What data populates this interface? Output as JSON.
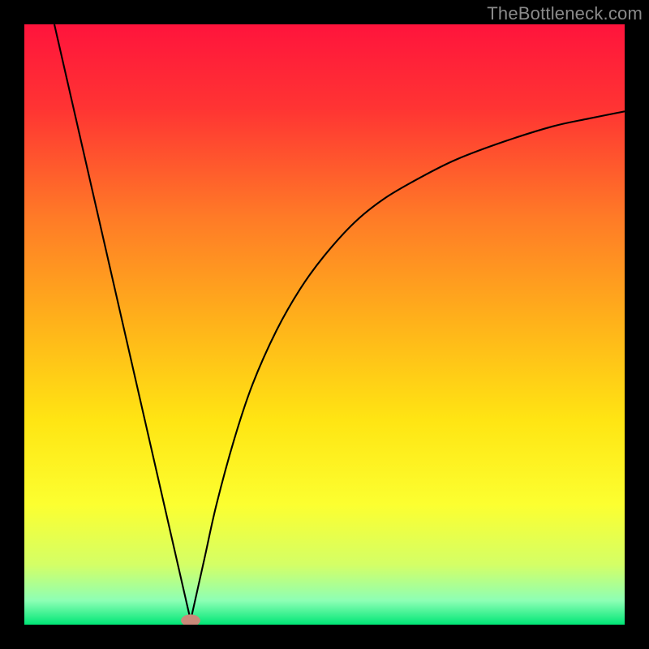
{
  "watermark": "TheBottleneck.com",
  "chart_data": {
    "type": "line",
    "title": "",
    "xlabel": "",
    "ylabel": "",
    "xlim": [
      0,
      100
    ],
    "ylim": [
      0,
      100
    ],
    "grid": false,
    "background_gradient": {
      "stops": [
        {
          "pct": 0,
          "color": "#ff143c"
        },
        {
          "pct": 14,
          "color": "#ff3433"
        },
        {
          "pct": 32,
          "color": "#ff7a27"
        },
        {
          "pct": 50,
          "color": "#ffb31a"
        },
        {
          "pct": 66,
          "color": "#ffe513"
        },
        {
          "pct": 80,
          "color": "#fcff30"
        },
        {
          "pct": 90,
          "color": "#d4ff66"
        },
        {
          "pct": 96,
          "color": "#8dffb5"
        },
        {
          "pct": 100,
          "color": "#00e676"
        }
      ]
    },
    "node": {
      "x": 27.7,
      "y": 0.7,
      "color": "#c98a7a",
      "rx": 1.6,
      "ry": 1.0
    },
    "series": [
      {
        "name": "left-branch",
        "type": "line",
        "x": [
          5.0,
          27.7
        ],
        "y": [
          100.0,
          0.7
        ],
        "stroke": "#000000",
        "width": 2.1
      },
      {
        "name": "right-branch",
        "type": "curve",
        "x": [
          27.7,
          30,
          32,
          35,
          38,
          42,
          46,
          50,
          55,
          60,
          66,
          72,
          80,
          88,
          94,
          100
        ],
        "y": [
          0.7,
          11,
          20,
          31,
          40,
          49,
          56,
          61.5,
          67,
          71,
          74.5,
          77.5,
          80.5,
          83,
          84.3,
          85.5
        ],
        "stroke": "#000000",
        "width": 2.1
      }
    ]
  }
}
